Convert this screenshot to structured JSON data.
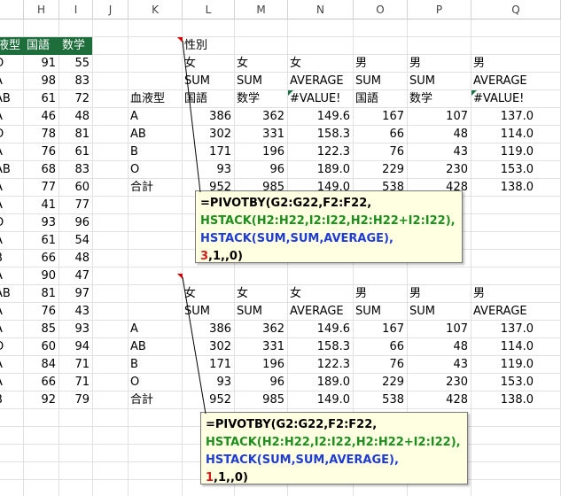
{
  "columns": [
    "H",
    "I",
    "J",
    "K",
    "L",
    "M",
    "N",
    "O",
    "P",
    "Q"
  ],
  "colors": {
    "green_header": "#1e6e3c",
    "formula_black": "#000000",
    "formula_green": "#1e8f1e",
    "formula_blue": "#1f3bd6",
    "formula_red": "#d81c1c"
  },
  "left_headers": {
    "g": "液型",
    "h": "国語",
    "i": "数学"
  },
  "left_rows": [
    {
      "g": "O",
      "h": "91",
      "i": "55"
    },
    {
      "g": "A",
      "h": "98",
      "i": "83"
    },
    {
      "g": "AB",
      "h": "61",
      "i": "72"
    },
    {
      "g": "A",
      "h": "46",
      "i": "48"
    },
    {
      "g": "O",
      "h": "78",
      "i": "81"
    },
    {
      "g": "A",
      "h": "76",
      "i": "61"
    },
    {
      "g": "AB",
      "h": "68",
      "i": "83"
    },
    {
      "g": "A",
      "h": "77",
      "i": "60"
    },
    {
      "g": "A",
      "h": "41",
      "i": "77"
    },
    {
      "g": "O",
      "h": "93",
      "i": "96"
    },
    {
      "g": "A",
      "h": "61",
      "i": "54"
    },
    {
      "g": "B",
      "h": "66",
      "i": "48"
    },
    {
      "g": "A",
      "h": "90",
      "i": "47"
    },
    {
      "g": "AB",
      "h": "81",
      "i": "97"
    },
    {
      "g": "A",
      "h": "76",
      "i": "43"
    },
    {
      "g": "A",
      "h": "85",
      "i": "93"
    },
    {
      "g": "O",
      "h": "60",
      "i": "94"
    },
    {
      "g": "A",
      "h": "84",
      "i": "71"
    },
    {
      "g": "A",
      "h": "66",
      "i": "71"
    },
    {
      "g": "B",
      "h": "92",
      "i": "79"
    }
  ],
  "pivot1": {
    "label_sex": "性別",
    "sex_row": [
      "女",
      "女",
      "女",
      "男",
      "男",
      "男"
    ],
    "agg_row": [
      "SUM",
      "SUM",
      "AVERAGE",
      "SUM",
      "SUM",
      "AVERAGE"
    ],
    "field_row_label": "血液型",
    "field_row": [
      "国語",
      "数学",
      "#VALUE!",
      "国語",
      "数学",
      "#VALUE!"
    ],
    "rows": [
      {
        "label": "A",
        "vals": [
          "386",
          "362",
          "149.6",
          "167",
          "107",
          "137.0"
        ]
      },
      {
        "label": "AB",
        "vals": [
          "302",
          "331",
          "158.3",
          "66",
          "48",
          "114.0"
        ]
      },
      {
        "label": "B",
        "vals": [
          "171",
          "196",
          "122.3",
          "76",
          "43",
          "119.0"
        ]
      },
      {
        "label": "O",
        "vals": [
          "93",
          "96",
          "189.0",
          "229",
          "230",
          "153.0"
        ]
      },
      {
        "label": "合計",
        "vals": [
          "952",
          "985",
          "149.0",
          "538",
          "428",
          "138.0"
        ]
      }
    ]
  },
  "pivot2": {
    "sex_row": [
      "女",
      "女",
      "女",
      "男",
      "男",
      "男"
    ],
    "agg_row": [
      "SUM",
      "SUM",
      "AVERAGE",
      "SUM",
      "SUM",
      "AVERAGE"
    ],
    "rows": [
      {
        "label": "A",
        "vals": [
          "386",
          "362",
          "149.6",
          "167",
          "107",
          "137.0"
        ]
      },
      {
        "label": "AB",
        "vals": [
          "302",
          "331",
          "158.3",
          "66",
          "48",
          "114.0"
        ]
      },
      {
        "label": "B",
        "vals": [
          "171",
          "196",
          "122.3",
          "76",
          "43",
          "119.0"
        ]
      },
      {
        "label": "O",
        "vals": [
          "93",
          "96",
          "189.0",
          "229",
          "230",
          "153.0"
        ]
      },
      {
        "label": "合計",
        "vals": [
          "952",
          "985",
          "149.0",
          "538",
          "428",
          "138.0"
        ]
      }
    ]
  },
  "comment1": {
    "line1": "=PIVOTBY(G2:G22,F2:F22,",
    "line2": "HSTACK(H2:H22,I2:I22,H2:H22+I2:I22),",
    "line3": "HSTACK(SUM,SUM,AVERAGE),",
    "line4_red": "3",
    "line4_rest": ",1,,0)"
  },
  "comment2": {
    "line1": "=PIVOTBY(G2:G22,F2:F22,",
    "line2": "HSTACK(H2:H22,I2:I22,H2:H22+I2:I22),",
    "line3": "HSTACK(SUM,SUM,AVERAGE),",
    "line4_red": "1",
    "line4_rest": ",1,,0)"
  }
}
